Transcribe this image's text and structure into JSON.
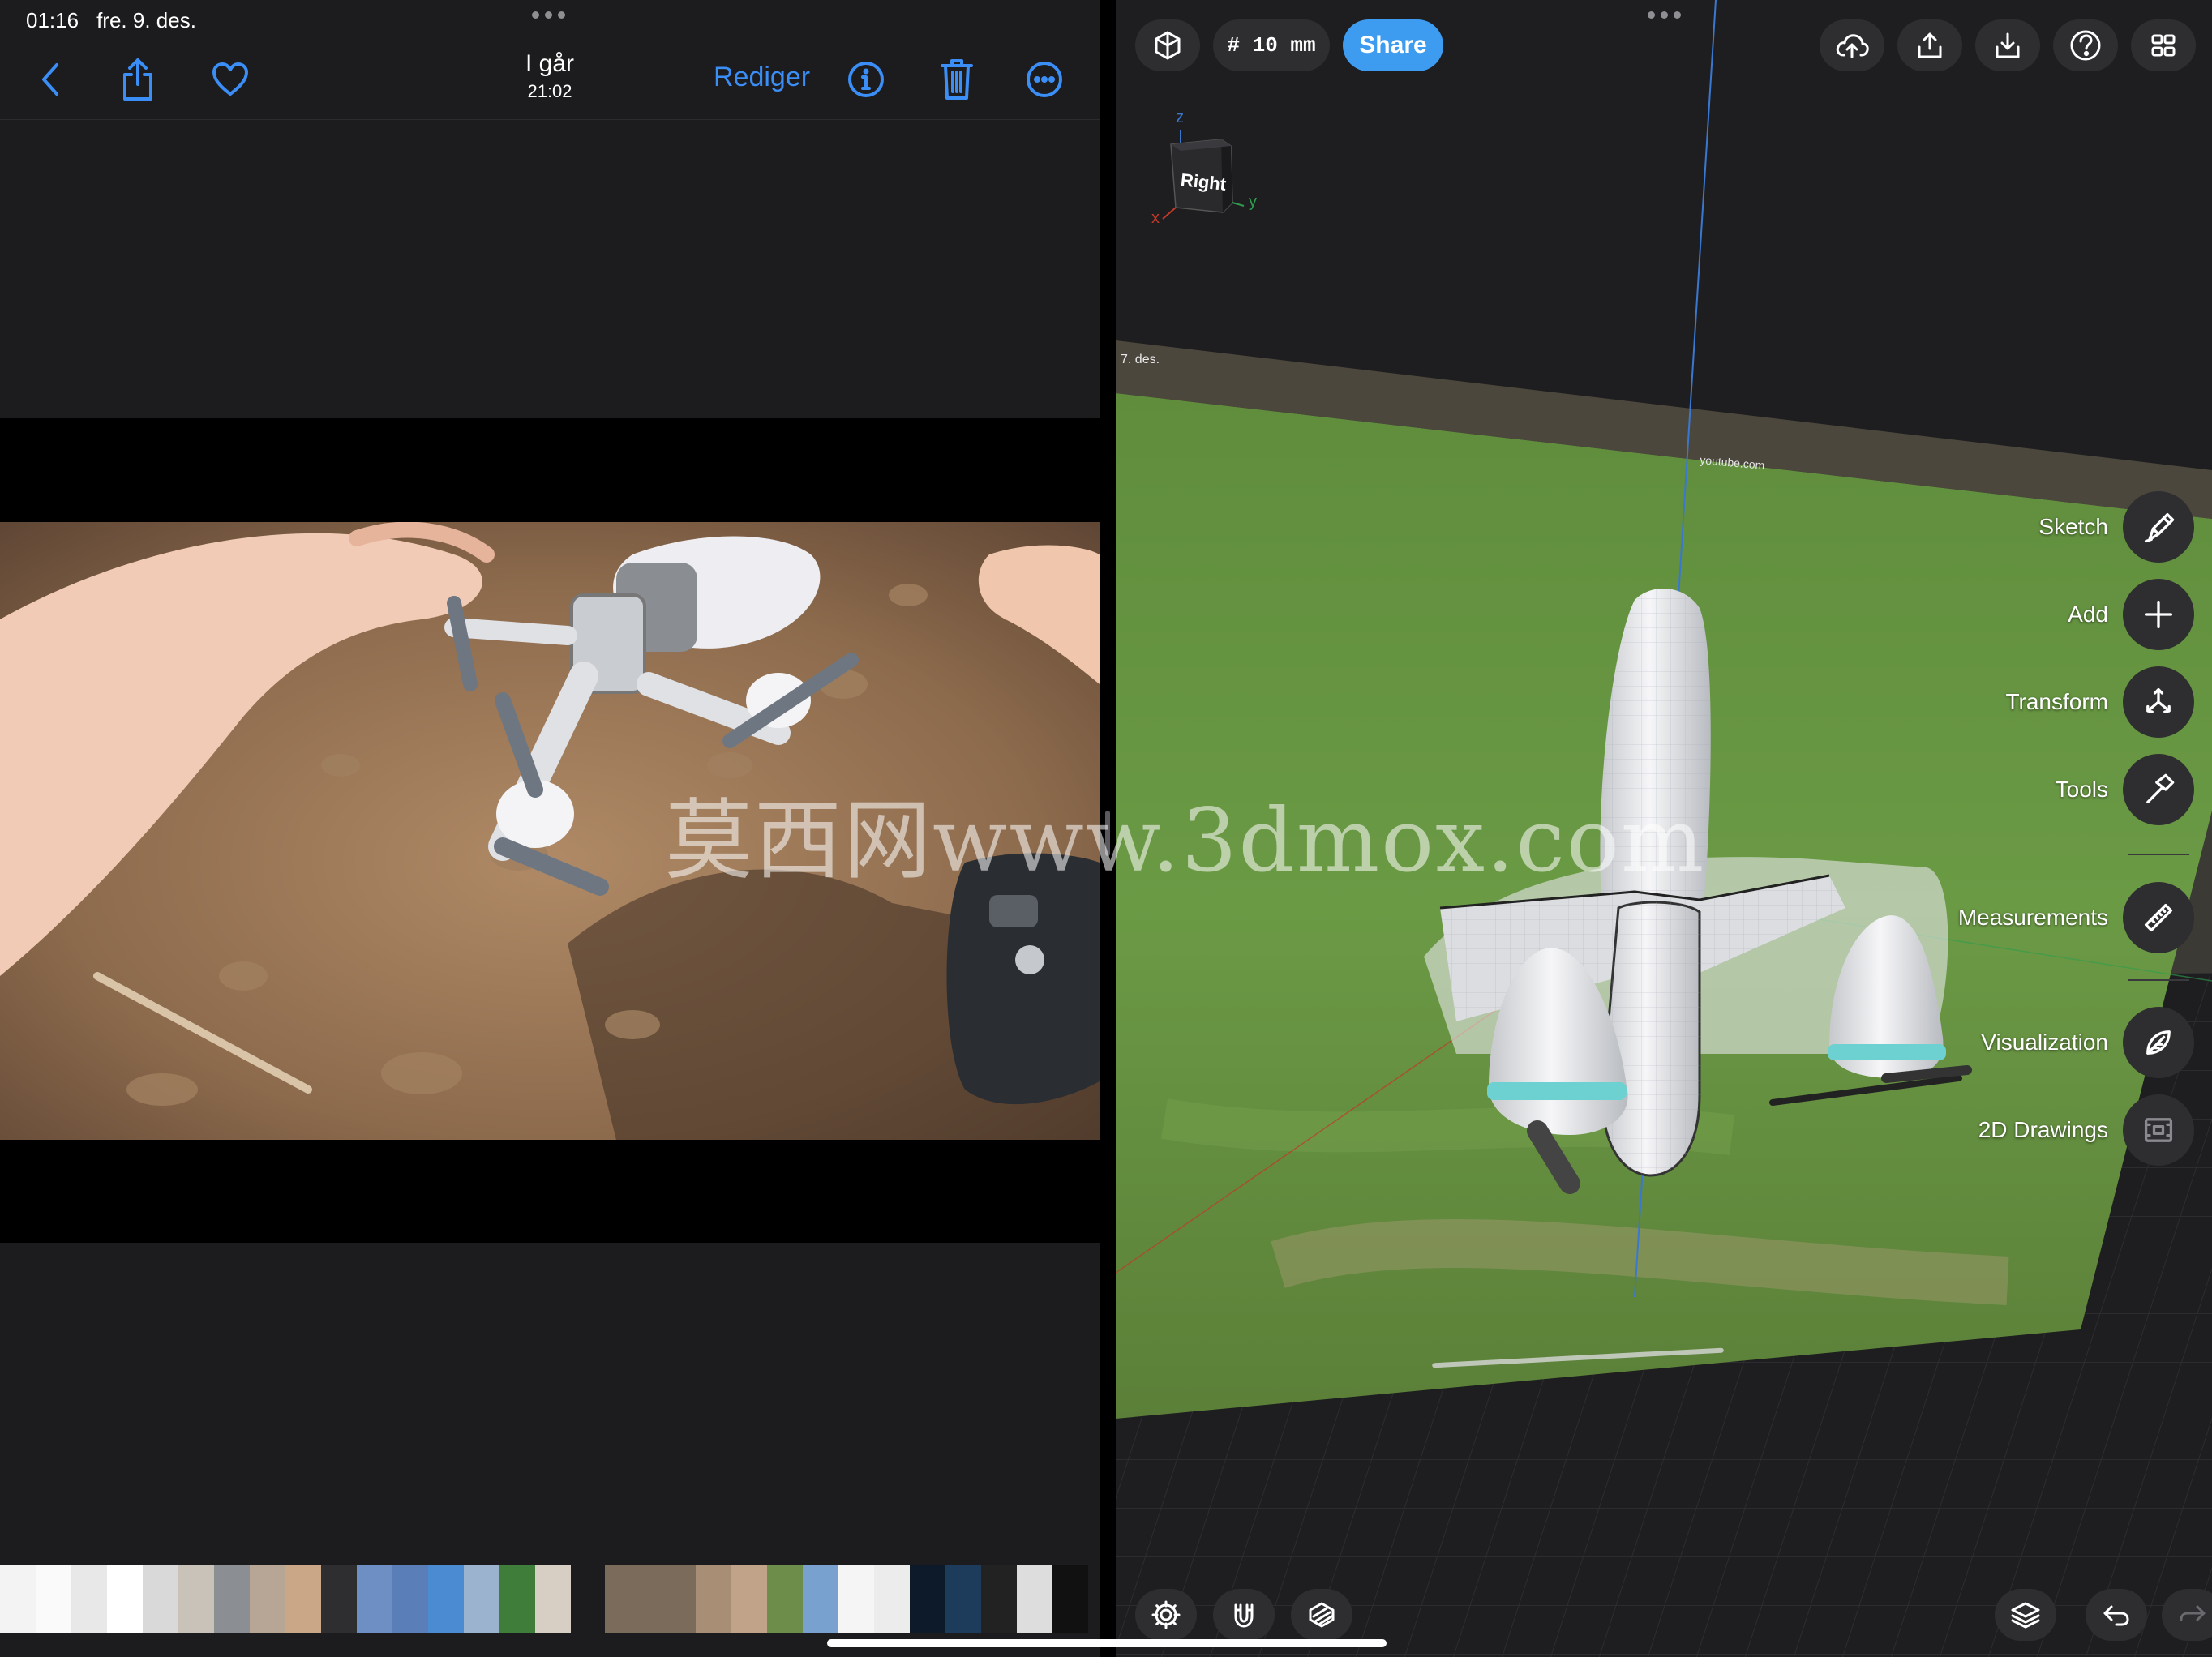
{
  "status": {
    "time": "01:16",
    "date": "fre. 9. des."
  },
  "photos": {
    "title": "I går",
    "subtitle": "21:02",
    "edit_label": "Rediger",
    "icons": [
      "chevron-left-icon",
      "share-icon",
      "heart-icon",
      "info-icon",
      "trash-icon",
      "more-icon"
    ]
  },
  "cad": {
    "grid_label": "# 10 mm",
    "share_label": "Share",
    "viewcube": {
      "face": "Right",
      "axis_x": "x",
      "axis_y": "y",
      "axis_z": "z"
    },
    "tools": [
      {
        "label": "Sketch",
        "icon": "pencil-icon"
      },
      {
        "label": "Add",
        "icon": "plus-icon"
      },
      {
        "label": "Transform",
        "icon": "transform-icon"
      },
      {
        "label": "Tools",
        "icon": "hammer-icon"
      },
      {
        "label": "Measurements",
        "icon": "ruler-icon"
      },
      {
        "label": "Visualization",
        "icon": "visualization-icon"
      },
      {
        "label": "2D Drawings",
        "icon": "drawing-icon"
      }
    ],
    "image_plane": {
      "date_text": "7. des.",
      "url_text": "youtube.com"
    }
  },
  "watermark": "莫西网www.3dmox.com",
  "colors": {
    "accent_blue": "#3a8ef6",
    "share_blue": "#3d9bf0",
    "panel_bg": "#1c1c1e",
    "cad_bg": "#1e1e20"
  }
}
